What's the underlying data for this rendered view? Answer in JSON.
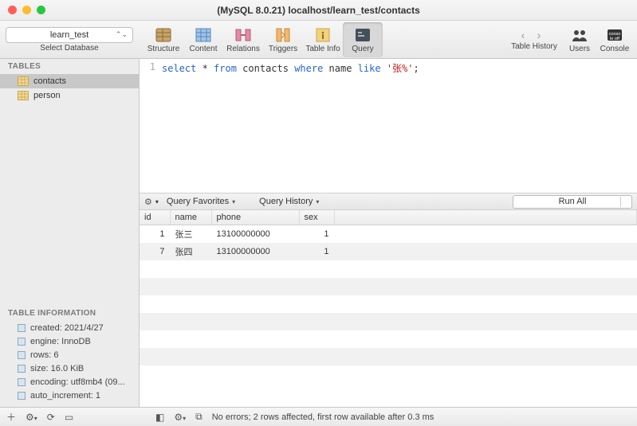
{
  "window": {
    "title": "(MySQL 8.0.21) localhost/learn_test/contacts"
  },
  "toolbar": {
    "db_selected": "learn_test",
    "db_label": "Select Database",
    "tools": {
      "structure": "Structure",
      "content": "Content",
      "relations": "Relations",
      "triggers": "Triggers",
      "table_info": "Table Info",
      "query": "Query"
    },
    "right": {
      "table_history": "Table History",
      "users": "Users",
      "console": "Console"
    }
  },
  "sidebar": {
    "tables_header": "TABLES",
    "tables": [
      "contacts",
      "person"
    ],
    "selected_table_index": 0,
    "info_header": "TABLE INFORMATION",
    "info": [
      "created: 2021/4/27",
      "engine: InnoDB",
      "rows: 6",
      "size: 16.0 KiB",
      "encoding: utf8mb4 (09...",
      "auto_increment: 1"
    ]
  },
  "editor": {
    "tokens": [
      {
        "t": "select",
        "c": "kw"
      },
      {
        "t": " * ",
        "c": ""
      },
      {
        "t": "from",
        "c": "kw"
      },
      {
        "t": " contacts ",
        "c": ""
      },
      {
        "t": "where",
        "c": "kw"
      },
      {
        "t": " name ",
        "c": ""
      },
      {
        "t": "like",
        "c": "kw"
      },
      {
        "t": " ",
        "c": ""
      },
      {
        "t": "'张%'",
        "c": "str"
      },
      {
        "t": ";",
        "c": ""
      }
    ],
    "line_no": "1"
  },
  "midbar": {
    "favorites": "Query Favorites",
    "history": "Query History",
    "run_all": "Run All"
  },
  "results": {
    "columns": [
      "id",
      "name",
      "phone",
      "sex"
    ],
    "rows": [
      {
        "id": "1",
        "name": "张三",
        "phone": "13100000000",
        "sex": "1"
      },
      {
        "id": "7",
        "name": "张四",
        "phone": "13100000000",
        "sex": "1"
      }
    ]
  },
  "status": {
    "text": "No errors; 2 rows affected, first row available after 0.3 ms"
  }
}
